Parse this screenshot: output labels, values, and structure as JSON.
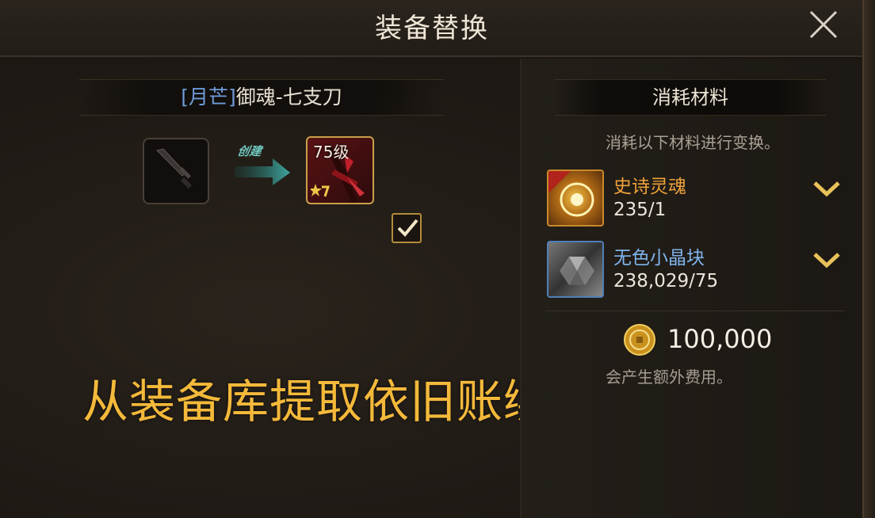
{
  "header": {
    "title": "装备替换"
  },
  "item": {
    "tag": "[月芒]",
    "name": "御魂-七支刀",
    "arrow_label": "创建",
    "level": "75级"
  },
  "overlay_caption": "从装备库提取依旧账绑",
  "materials": {
    "title": "消耗材料",
    "description": "消耗以下材料进行变换。",
    "items": [
      {
        "name": "史诗灵魂",
        "quantity": "235/1",
        "icon": "epic-soul-icon",
        "color": "#f0a23a"
      },
      {
        "name": "无色小晶块",
        "quantity": "238,029/75",
        "icon": "colorless-crystal-icon",
        "color": "#7fb4ec"
      }
    ]
  },
  "cost": {
    "value": "100,000",
    "currency_icon": "gold-coin-icon",
    "note": "会产生额外费用。"
  },
  "colors": {
    "accent_gold": "#f4b93a",
    "frame_gold": "#c9a04a",
    "arrow_teal": "#3fa79f"
  }
}
